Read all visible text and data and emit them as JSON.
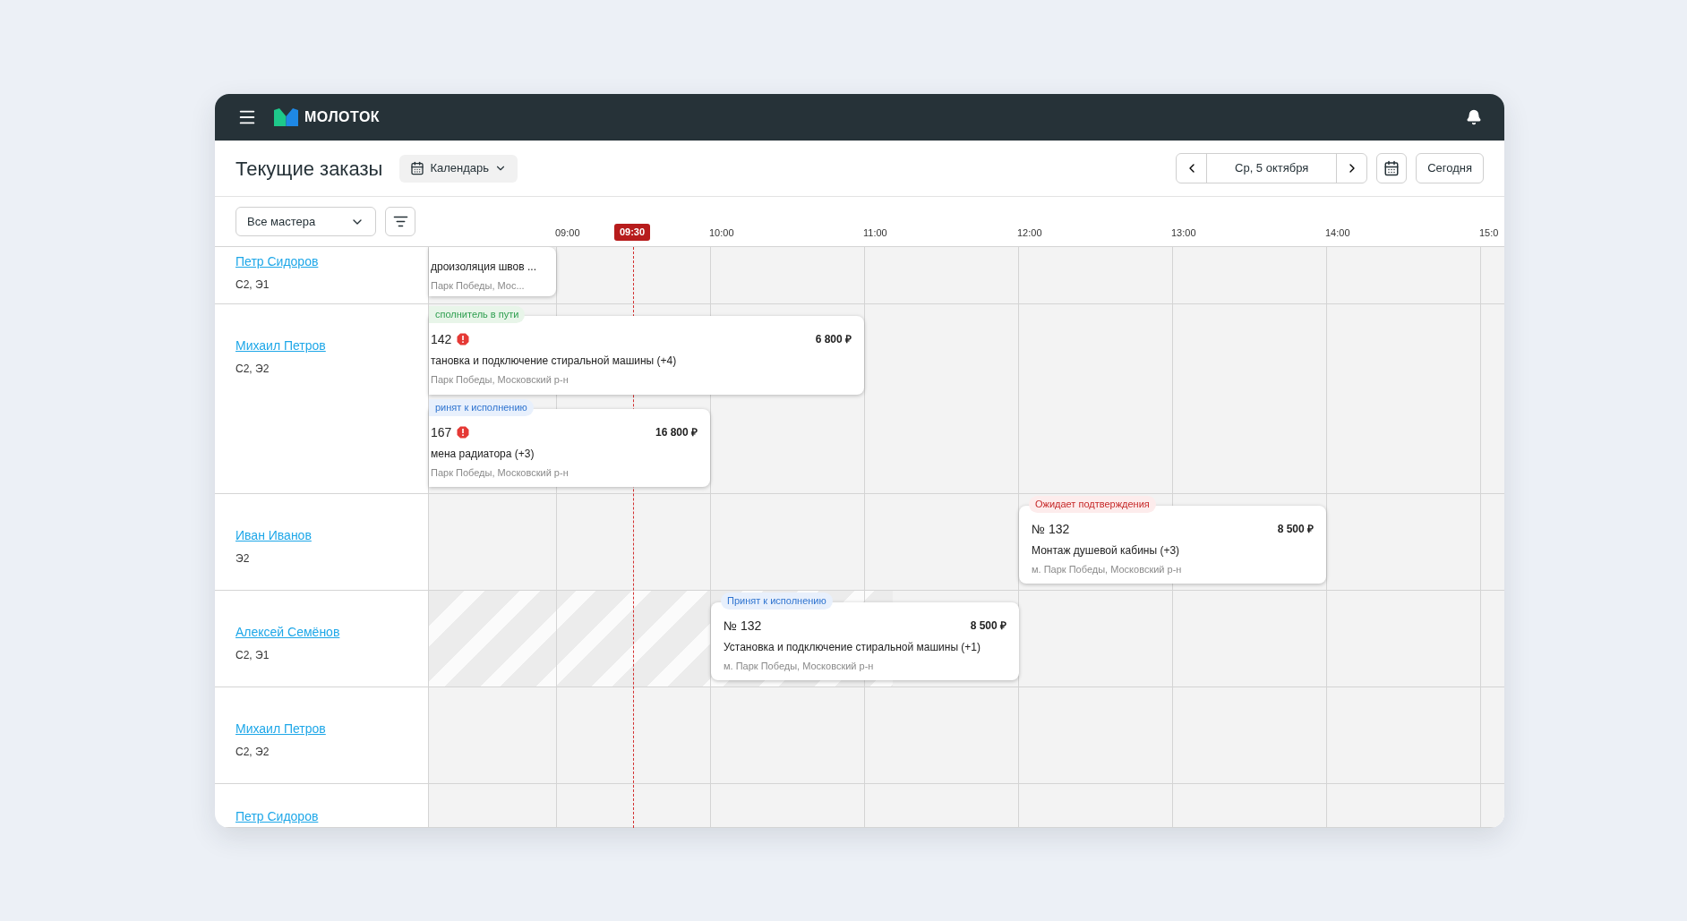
{
  "topbar": {
    "logo": "МОЛОТОК"
  },
  "header": {
    "title": "Текущие заказы",
    "view_button": "Календарь",
    "date": "Ср, 5 октября",
    "today_button": "Сегодня"
  },
  "filter": {
    "select": "Все мастера"
  },
  "timeline": {
    "hours": [
      "09:00",
      "10:00",
      "11:00",
      "12:00",
      "13:00",
      "14:00",
      "15:0"
    ],
    "now": "09:30"
  },
  "rows": [
    {
      "name": "Петр Сидоров",
      "skills": "С2, Э1",
      "unavailable": false,
      "orders": [
        {
          "title": "дроизоляция швов ...",
          "address": "Парк Победы, Мос..."
        }
      ]
    },
    {
      "name": "Михаил Петров",
      "skills": "С2, Э2",
      "unavailable": false,
      "orders": [
        {
          "status": "сполнитель в пути",
          "kind": "en_route",
          "number": "142",
          "alert": true,
          "price": "6 800 ₽",
          "title": "тановка и подключение стиральной машины (+4)",
          "address": "Парк Победы, Московский р-н"
        },
        {
          "status": "ринят к исполнению",
          "kind": "accepted",
          "number": "167",
          "alert": true,
          "price": "16 800 ₽",
          "title": "мена радиатора (+3)",
          "address": "Парк Победы, Московский р-н"
        }
      ]
    },
    {
      "name": "Иван Иванов",
      "skills": "Э2",
      "unavailable": false,
      "orders": [
        {
          "status": "Ожидает подтверждения",
          "kind": "pending",
          "number": "№ 132",
          "alert": false,
          "price": "8 500 ₽",
          "title": "Монтаж душевой кабины (+3)",
          "address": "м. Парк Победы, Московский р-н"
        }
      ]
    },
    {
      "name": "Алексей Семёнов",
      "skills": "С2, Э1",
      "unavailable": true,
      "orders": [
        {
          "status": "Принят к исполнению",
          "kind": "accepted",
          "number": "№ 132",
          "alert": false,
          "price": "8 500 ₽",
          "title": "Установка и подключение стиральной машины (+1)",
          "address": "м. Парк Победы, Московский р-н"
        }
      ]
    },
    {
      "name": "Михаил Петров",
      "skills": "С2, Э2",
      "unavailable": false,
      "orders": []
    },
    {
      "name": "Петр Сидоров",
      "unavailable": false,
      "orders": []
    }
  ]
}
